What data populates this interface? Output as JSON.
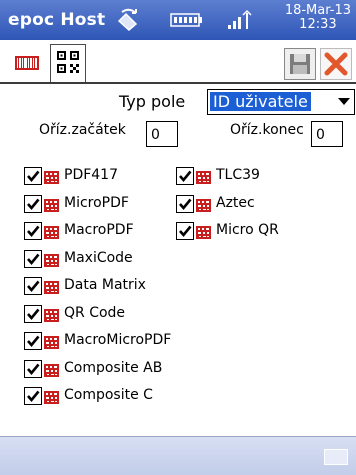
{
  "titlebar": {
    "title": "epoc Host",
    "date": "18-Mar-13",
    "time": "12:33",
    "icons": [
      "sync-icon",
      "battery-icon",
      "signal-icon"
    ]
  },
  "toolbar": {
    "tabs": [
      "barcode-1d-tab",
      "qr-code-tab"
    ],
    "buttons": [
      "save-button",
      "close-button"
    ]
  },
  "form": {
    "field_type_label": "Typ pole",
    "field_type_value": "ID uživatele",
    "trim_start_label": "Oříz.začátek",
    "trim_start_value": "0",
    "trim_end_label": "Oříz.konec",
    "trim_end_value": "0"
  },
  "symbologies": {
    "left": [
      {
        "label": "PDF417",
        "checked": true
      },
      {
        "label": "MicroPDF",
        "checked": true
      },
      {
        "label": "MacroPDF",
        "checked": true
      },
      {
        "label": "MaxiCode",
        "checked": true
      },
      {
        "label": "Data Matrix",
        "checked": true
      },
      {
        "label": "QR Code",
        "checked": true
      },
      {
        "label": "MacroMicroPDF",
        "checked": true
      },
      {
        "label": "Composite AB",
        "checked": true
      },
      {
        "label": "Composite C",
        "checked": true
      }
    ],
    "right": [
      {
        "label": "TLC39",
        "checked": true
      },
      {
        "label": "Aztec",
        "checked": true
      },
      {
        "label": "Micro QR",
        "checked": true
      }
    ]
  },
  "colors": {
    "titlebar": "#3a60c0",
    "selection": "#1c5fd4",
    "barcode_icon": "#c81e1e",
    "bottombar": "#c8d2ec"
  }
}
